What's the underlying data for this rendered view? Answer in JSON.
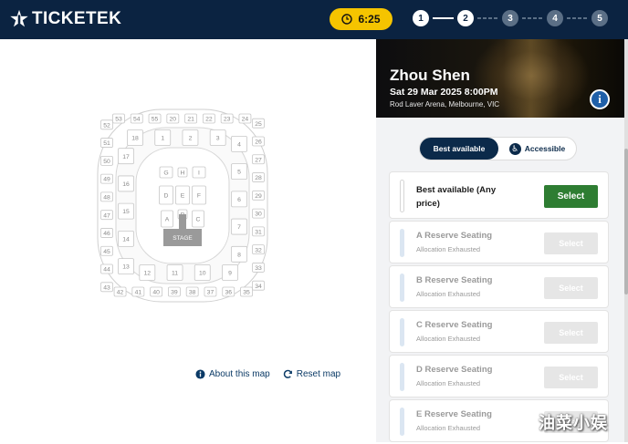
{
  "header": {
    "brand": "TICKETEK",
    "timer": "6:25",
    "steps": [
      "1",
      "2",
      "3",
      "4",
      "5"
    ],
    "colors": {
      "header_bg": "#0b2341",
      "timer_bg": "#f5c400"
    }
  },
  "seat_map": {
    "stage_label": "STAGE",
    "outer_sections": [
      "52",
      "53",
      "54",
      "55",
      "20",
      "21",
      "22",
      "23",
      "24",
      "25",
      "26",
      "27",
      "28",
      "29",
      "30",
      "31",
      "32",
      "33",
      "34",
      "35",
      "36",
      "37",
      "38",
      "39",
      "40",
      "41",
      "42",
      "43",
      "44",
      "45",
      "46",
      "47",
      "48",
      "49",
      "50",
      "51"
    ],
    "middle_sections": [
      "17",
      "18",
      "1",
      "2",
      "3",
      "4",
      "5",
      "6",
      "7",
      "8",
      "9",
      "10",
      "11",
      "12",
      "13",
      "14",
      "15",
      "16"
    ],
    "floor_sections": [
      "G",
      "H",
      "I",
      "D",
      "E",
      "F",
      "A",
      "B",
      "C"
    ]
  },
  "map_links": {
    "about": "About this map",
    "reset": "Reset map"
  },
  "event": {
    "artist": "Zhou Shen",
    "date": "Sat 29 Mar 2025 8:00PM",
    "venue": "Rod Laver Arena, Melbourne, VIC"
  },
  "toggle": {
    "best": "Best available",
    "accessible": "Accessible"
  },
  "tickets": [
    {
      "name": "Best available (Any price)",
      "sub": "",
      "button": "Select",
      "enabled": true
    },
    {
      "name": "A Reserve Seating",
      "sub": "Allocation Exhausted",
      "button": "Select",
      "enabled": false
    },
    {
      "name": "B Reserve Seating",
      "sub": "Allocation Exhausted",
      "button": "Select",
      "enabled": false
    },
    {
      "name": "C Reserve Seating",
      "sub": "Allocation Exhausted",
      "button": "Select",
      "enabled": false
    },
    {
      "name": "D Reserve Seating",
      "sub": "Allocation Exhausted",
      "button": "Select",
      "enabled": false
    },
    {
      "name": "E Reserve Seating",
      "sub": "Allocation Exhausted",
      "button": "Select",
      "enabled": false
    }
  ],
  "watermark": "油菜小娱"
}
